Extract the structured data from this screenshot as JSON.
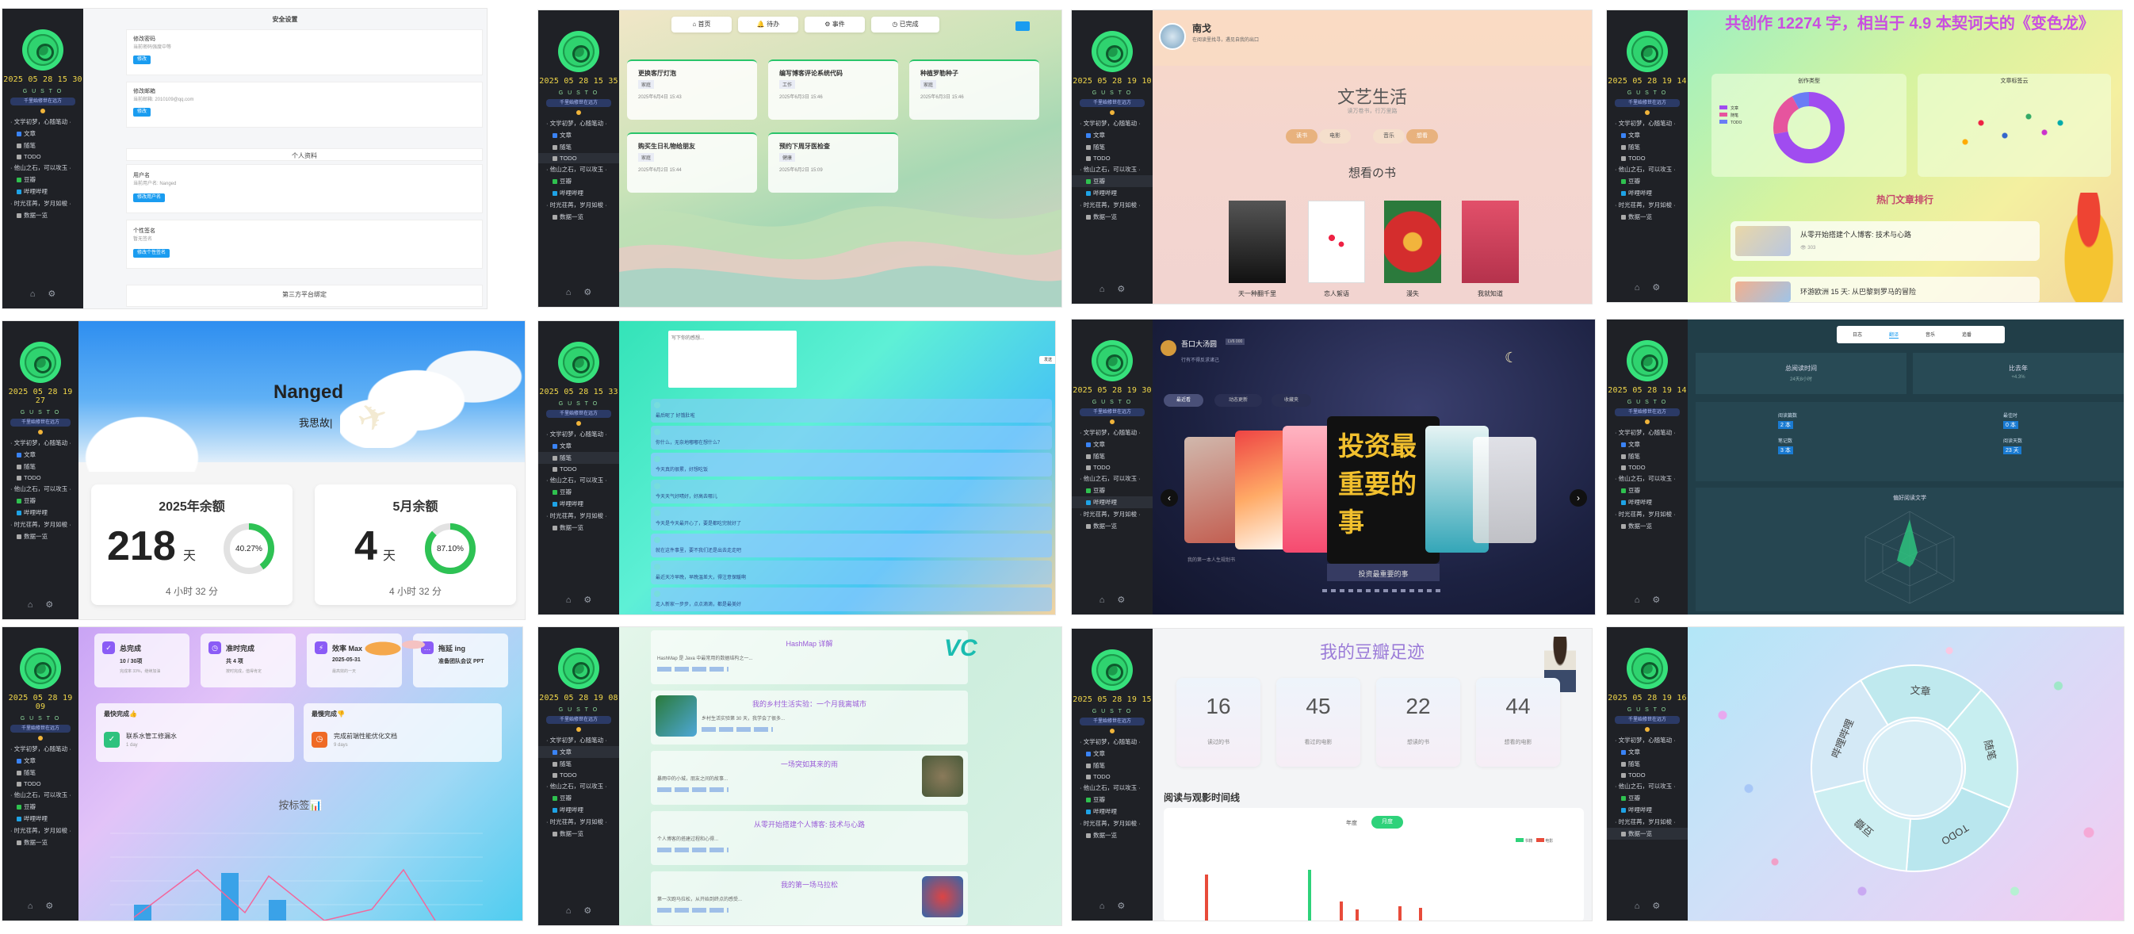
{
  "sidebar": {
    "clocks": [
      "2025 05 28 15 30",
      "2025 05 28 15 35",
      "2025 05 28 19 10",
      "2025 05 28 19 14",
      "2025 05 28 19 27",
      "2025 05 28 15 33",
      "2025 05 28 19 30",
      "2025 05 28 19 14",
      "2025 05 28 19 09",
      "2025 05 28 19 08",
      "2025 05 28 19 15",
      "2025 05 28 19 16"
    ],
    "tag": "G U S T O",
    "pill": "千里始修世在远方",
    "items": [
      {
        "label": "· 文学初梦，心随笔动 ·",
        "sub": false,
        "color": ""
      },
      {
        "label": "文章",
        "sub": true,
        "color": "#3a83f5"
      },
      {
        "label": "随笔",
        "sub": true,
        "color": "#aaaaaa"
      },
      {
        "label": "TODO",
        "sub": true,
        "color": "#aaaaaa"
      },
      {
        "label": "· 他山之石，可以攻玉 ·",
        "sub": false,
        "color": ""
      },
      {
        "label": "豆瓣",
        "sub": true,
        "color": "#2fc14f"
      },
      {
        "label": "哔哩哔哩",
        "sub": true,
        "color": "#1ea3e6"
      },
      {
        "label": "· 时光荏苒，岁月如梭 ·",
        "sub": false,
        "color": ""
      },
      {
        "label": "数据一览",
        "sub": true,
        "color": "#aaaaaa"
      }
    ],
    "foot_home": "⌂",
    "foot_gear": "⚙"
  },
  "p1": {
    "section_security": "安全设置",
    "rows": [
      {
        "title": "修改密码",
        "desc": "当前密码强度中等",
        "btn": "修改"
      },
      {
        "title": "修改邮箱",
        "desc": "当前邮箱: 2010109@qq.com",
        "btn": "修改"
      }
    ],
    "section_profile": "个人资料",
    "rows2": [
      {
        "title": "用户名",
        "desc": "当前用户名: Nanged",
        "btn": "修改用户名"
      },
      {
        "title": "个性签名",
        "desc": "暂无签名",
        "btn": "修改个性签名"
      }
    ],
    "section_third": "第三方平台绑定"
  },
  "p2": {
    "tabs": [
      "首页",
      "待办",
      "事件",
      "已完成"
    ],
    "cards": [
      {
        "title": "更换客厅灯泡",
        "badge": "家庭",
        "date": "2025年6月4日 15:43"
      },
      {
        "title": "编写博客评论系统代码",
        "badge": "工作",
        "date": "2025年6月3日 15:46"
      },
      {
        "title": "种植罗勒种子",
        "badge": "家庭",
        "date": "2025年6月3日 15:46"
      },
      {
        "title": "购买生日礼物给朋友",
        "badge": "家庭",
        "date": "2025年6月2日 15:44"
      },
      {
        "title": "预约下周牙医检查",
        "badge": "健康",
        "date": "2025年6月2日 15:09"
      }
    ]
  },
  "p3": {
    "name": "南戈",
    "bio": "在阅读里找寻，遇见自我的出口",
    "title": "文艺生活",
    "subtitle": "读万卷书，行万里路",
    "tabs": [
      "读书",
      "电影",
      "音乐",
      "想看"
    ],
    "section": "想看の书",
    "books": [
      "天一种翻千里",
      "恋人絮语",
      "漫失",
      "我就知道"
    ]
  },
  "p4": {
    "headline": "共创作 12274 字，相当于 4.9 本契诃夫的《变色龙》",
    "chart1_title": "创作类型",
    "chart2_title": "文章标签云",
    "hot_title": "热门文章排行",
    "articles": [
      {
        "title": "从零开始搭建个人博客: 技术与心路",
        "meta": "👁 303"
      },
      {
        "title": "环游欧洲 15 天: 从巴黎到罗马的冒险",
        "meta": ""
      }
    ],
    "pie": {
      "segments": [
        {
          "label": "文章",
          "value": 72,
          "color": "#a04cf0"
        },
        {
          "label": "随笔",
          "value": 20,
          "color": "#e6549e"
        },
        {
          "label": "TODO",
          "value": 8,
          "color": "#6a7cf5"
        }
      ]
    }
  },
  "p5": {
    "name": "Nanged",
    "motto": "我思故|",
    "card1": {
      "title": "2025年余额",
      "value": "218",
      "unit": "天",
      "pct": "40.27%",
      "pct_value": 40.27,
      "foot": "4 小时 32 分"
    },
    "card2": {
      "title": "5月余额",
      "value": "4",
      "unit": "天",
      "pct": "87.10%",
      "pct_value": 87.1,
      "foot": "4 小时 32 分"
    }
  },
  "p6": {
    "input_placeholder": "写下你的感想...",
    "send": "发送",
    "msgs": [
      "最后呢了 好饿肚啦",
      "你什么，无奈地嘟嘟在想什么？",
      "今天真的很累，好想吃饭",
      "今天天气好晴好，好高去哪儿",
      "今天是今天最开心了，要是都吃完就好了",
      "就在这件事里，要不我们还是出去走走吧",
      "最近天冷早晚，早晚温差大，得注意保暖啊",
      "走入新家一步步，点点滴滴，都是最美好"
    ]
  },
  "p7": {
    "user": "吾口大汤圆",
    "badge": "LV6 000",
    "bio": "行有不得反求诸己",
    "filters": [
      "最近看",
      "动态更新",
      "收藏夹"
    ],
    "center_book": "投资最重要的事",
    "center_caption": "投资最重要的事",
    "left_caption": "我的第一本人生规划书"
  },
  "p8": {
    "tabs": [
      "日志",
      "翻译",
      "音乐",
      "追番"
    ],
    "stat1_label": "总阅读时间",
    "stat1_value": "24天8小时",
    "stat2_label": "比去年",
    "stat2_value": "+4.3%",
    "mini": [
      {
        "label": "阅读篇数",
        "value": "2 本"
      },
      {
        "label": "最佳时",
        "value": "0 本"
      },
      {
        "label": "笔记数",
        "value": "3 本"
      },
      {
        "label": "阅读天数",
        "value": "23 天"
      }
    ],
    "radar_title": "偏好阅读文学"
  },
  "p9": {
    "stats": [
      {
        "label": "总完成",
        "value": "10 / 30项",
        "sub": "完成率 33%，继续加油"
      },
      {
        "label": "准时完成",
        "value": "共 4 项",
        "sub": "按时完成，值得肯定"
      },
      {
        "label": "效率 Max",
        "value": "2025-05-31",
        "sub": "最高效的一天"
      },
      {
        "label": "拖延 ing",
        "value": "准备团队会议 PPT",
        "sub": ""
      }
    ],
    "fast_title": "最快完成👍",
    "fast_item": "联系水管工修漏水",
    "fast_sub": "1 day",
    "slow_title": "最慢完成👎",
    "slow_item": "完成前端性能优化文档",
    "slow_sub": "9 days",
    "chart_title": "按标签📊"
  },
  "p10": {
    "posts": [
      {
        "title": "HashMap 详解",
        "desc": "HashMap 是 Java 中最常用的数据结构之一..."
      },
      {
        "title": "我的乡村生活实验：一个月我离城市",
        "desc": "乡村生活实验第 30 天，我学会了很多..."
      },
      {
        "title": "一场突如其来的雨",
        "desc": "暴雨中的小城，朋友之间的故事..."
      },
      {
        "title": "从零开始搭建个人博客: 技术与心路",
        "desc": "个人博客的搭建过程和心得..."
      },
      {
        "title": "我的第一场马拉松",
        "desc": "第一次跑马拉松，从开始到终点的感受..."
      }
    ],
    "logo": "VC"
  },
  "p11": {
    "title": "我的豆瓣足迹",
    "stats": [
      {
        "value": "16",
        "label": "读过的书"
      },
      {
        "value": "45",
        "label": "看过的电影"
      },
      {
        "value": "22",
        "label": "想读的书"
      },
      {
        "value": "44",
        "label": "想看的电影"
      }
    ],
    "timeline_title": "阅读与观影时间线",
    "toggle": [
      "年度",
      "月度"
    ],
    "legend": [
      "书籍",
      "电影"
    ]
  },
  "p12": {
    "wheel": [
      "文章",
      "随笔",
      "TODO",
      "豆瓣",
      "哔哩哔哩"
    ]
  },
  "colors": {
    "green_logo": "#2fd36f",
    "clock": "#f2d84a",
    "accent_blue": "#1a9cf0",
    "pie_purple": "#a04cf0",
    "pie_pink": "#e6549e"
  }
}
